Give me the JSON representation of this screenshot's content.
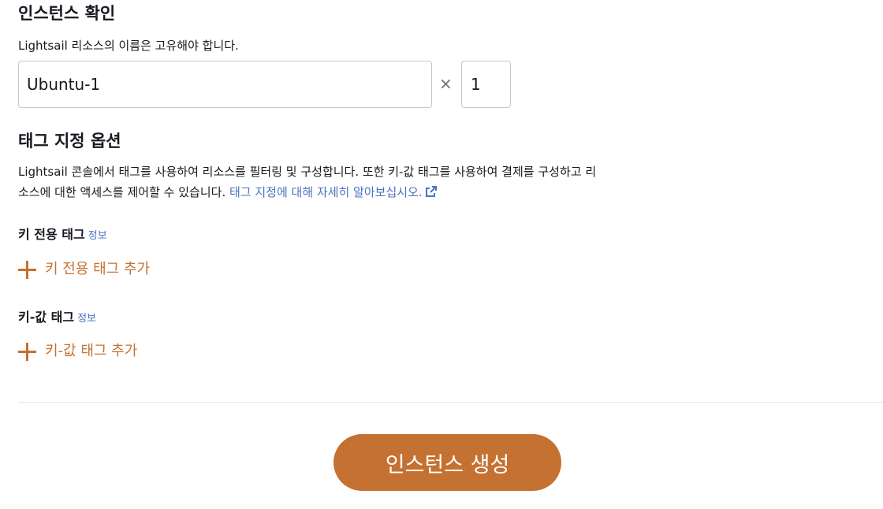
{
  "confirm_section": {
    "title": "인스턴스 확인",
    "description": "Lightsail 리소스의 이름은 고유해야 합니다.",
    "name_value": "Ubuntu-1",
    "multiplier_symbol": "×",
    "count_value": "1"
  },
  "tag_section": {
    "title": "태그 지정 옵션",
    "description_line1": "Lightsail 콘솔에서 태그를 사용하여 리소스를 필터링 및 구성합니다. 또한 키-값 태그를 사용하여 결제를 구성하고 리",
    "description_line2": "소스에 대한 액세스를 제어할 수 있습니다. ",
    "learn_more_link": "태그 지정에 대해 자세히 알아보십시오.",
    "key_only": {
      "label": "키 전용 태그",
      "info": "정보",
      "add_label": "키 전용 태그 추가"
    },
    "key_value": {
      "label": "키-값 태그",
      "info": "정보",
      "add_label": "키-값 태그 추가"
    }
  },
  "footer": {
    "create_button_label": "인스턴스 생성"
  },
  "colors": {
    "accent": "#c57131",
    "link": "#4a72c0",
    "text": "#16191f",
    "border": "#c4c7cc",
    "divider": "#e5e7ea"
  },
  "icons": {
    "external_link": "external-link-icon",
    "plus": "plus-icon"
  }
}
